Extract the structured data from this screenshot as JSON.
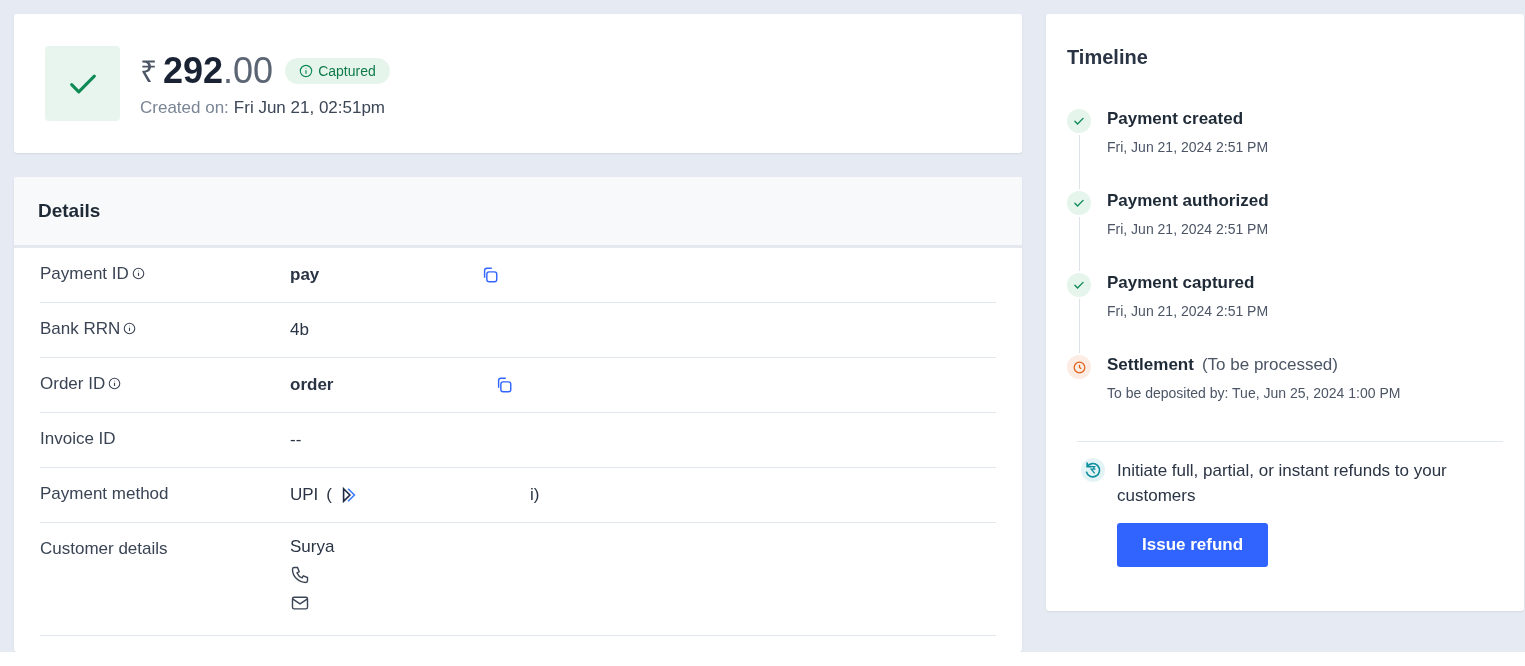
{
  "summary": {
    "currency": "₹",
    "amount_whole": "292",
    "amount_fraction": ".00",
    "status": "Captured",
    "created_label": "Created on:",
    "created_value": "Fri Jun 21, 02:51pm"
  },
  "details": {
    "title": "Details",
    "rows": [
      {
        "label": "Payment ID",
        "info": true,
        "kind": "copy",
        "value": "pay"
      },
      {
        "label": "Bank RRN",
        "info": true,
        "kind": "plain",
        "value": "4b"
      },
      {
        "label": "Order ID",
        "info": true,
        "kind": "copy",
        "value": "order"
      },
      {
        "label": "Invoice ID",
        "info": false,
        "kind": "plain",
        "value": "--"
      },
      {
        "label": "Payment method",
        "info": false,
        "kind": "upi",
        "value": "UPI",
        "prefix": "(",
        "suffix": "i)"
      },
      {
        "label": "Customer details",
        "info": false,
        "kind": "customer",
        "value": "Surya"
      }
    ]
  },
  "timeline": {
    "title": "Timeline",
    "events": [
      {
        "kind": "done",
        "title": "Payment created",
        "time": "Fri, Jun 21, 2024 2:51 PM"
      },
      {
        "kind": "done",
        "title": "Payment authorized",
        "time": "Fri, Jun 21, 2024 2:51 PM"
      },
      {
        "kind": "done",
        "title": "Payment captured",
        "time": "Fri, Jun 21, 2024 2:51 PM"
      },
      {
        "kind": "pending",
        "title": "Settlement",
        "note": "(To be processed)",
        "time": "To be deposited by: Tue, Jun 25, 2024 1:00 PM"
      }
    ],
    "refund_text": "Initiate full, partial, or instant refunds to your customers",
    "refund_button": "Issue refund"
  }
}
